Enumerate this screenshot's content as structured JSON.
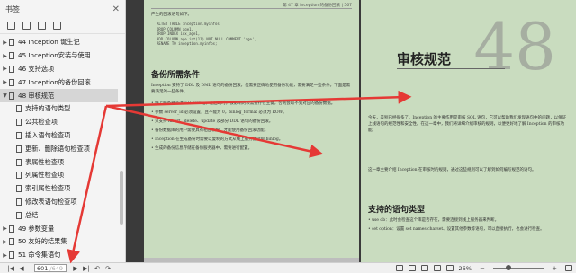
{
  "sidebar": {
    "title": "书签",
    "items": [
      {
        "label": "44 Inception 诞生记",
        "level": 1,
        "expanded": false,
        "active": false
      },
      {
        "label": "45 Inception安装与使用",
        "level": 1,
        "expanded": false,
        "active": false
      },
      {
        "label": "46 支持选项",
        "level": 1,
        "expanded": false,
        "active": false
      },
      {
        "label": "47 Inception的备份回滚",
        "level": 1,
        "expanded": false,
        "active": false
      },
      {
        "label": "48 审核规范",
        "level": 1,
        "expanded": true,
        "active": true
      },
      {
        "label": "支持的语句类型",
        "level": 2,
        "active": false
      },
      {
        "label": "公共检查项",
        "level": 2,
        "active": false
      },
      {
        "label": "插入语句检查项",
        "level": 2,
        "active": false
      },
      {
        "label": "更新、删除语句检查项",
        "level": 2,
        "active": false
      },
      {
        "label": "表属性检查项",
        "level": 2,
        "active": false
      },
      {
        "label": "列属性检查项",
        "level": 2,
        "active": false
      },
      {
        "label": "索引属性检查项",
        "level": 2,
        "active": false
      },
      {
        "label": "修改表语句检查项",
        "level": 2,
        "active": false
      },
      {
        "label": "总结",
        "level": 2,
        "active": false
      },
      {
        "label": "49 参数变量",
        "level": 1,
        "expanded": false,
        "active": false
      },
      {
        "label": "50 友好的结果集",
        "level": 1,
        "expanded": false,
        "active": false
      },
      {
        "label": "51 命令集语句",
        "level": 1,
        "expanded": false,
        "active": false
      }
    ]
  },
  "left_page": {
    "header": "第 47 章  Inception 的备份回滚 | 567",
    "intro": "产生的回滚语句如下。",
    "code": [
      "ALTER TABLE inception.myinfos",
      "DROP COLUMN age1,",
      "DROP INDEX idx_age1,",
      "ADD COLUMN age int(11) NOT NULL COMMENT 'age',",
      "RENAME TO inception.myinfos;"
    ],
    "section_title": "备份所需条件",
    "paragraph": "Inception 支持了 DDL 及 DML 语句的备份回滚，但需要正确地使用备份功能，需要满足一些条件。下面是需要满足的一些条件。",
    "bullets": [
      "线上服务器必须打开 binlog，在启动时，被影响的表需要存在主键，否则会取不到对应的备份数据。",
      "参数 server_id 必须设置，且不能为 0，binlog_format 必须为 ROW。",
      "只支持 insert、delete、update 及部分 DDL 语句的备份回滚。",
      "备份数据库的用户需要具有相应权限，才能使用备份回滚功能。",
      "Inception 在生成备份时需要以复制的方式从线上服务器读取 binlog。",
      "生成的备份信息存储在备份服务器中，需要进行配置。"
    ]
  },
  "right_page": {
    "chapter_number": "48",
    "chapter_title": "审核规范",
    "intro": "今天，差别已经很多了。Inception 的主要作用是审核 SQL 语句，它可以帮助我们发现语句中的问题，以保证上线语句的规范性和安全性。在这一章中，我们将详细介绍审核的规则，以便更好地了解 Inception 的审核功能。",
    "intro2": "这一章主要介绍 Inception 在审核时的规则，通过这些规则可以了解到如何编写规范的语句。",
    "section_title": "支持的语句类型",
    "bullets": [
      "use db：此时会检查这个库是否存在，需要连接到线上服务器来判断。",
      "set option：设置 set names charset、设置其他参数等语句，可以直接执行，也会进行检查。"
    ]
  },
  "status": {
    "page_current": "601",
    "page_total": "/649",
    "zoom": "26%"
  }
}
